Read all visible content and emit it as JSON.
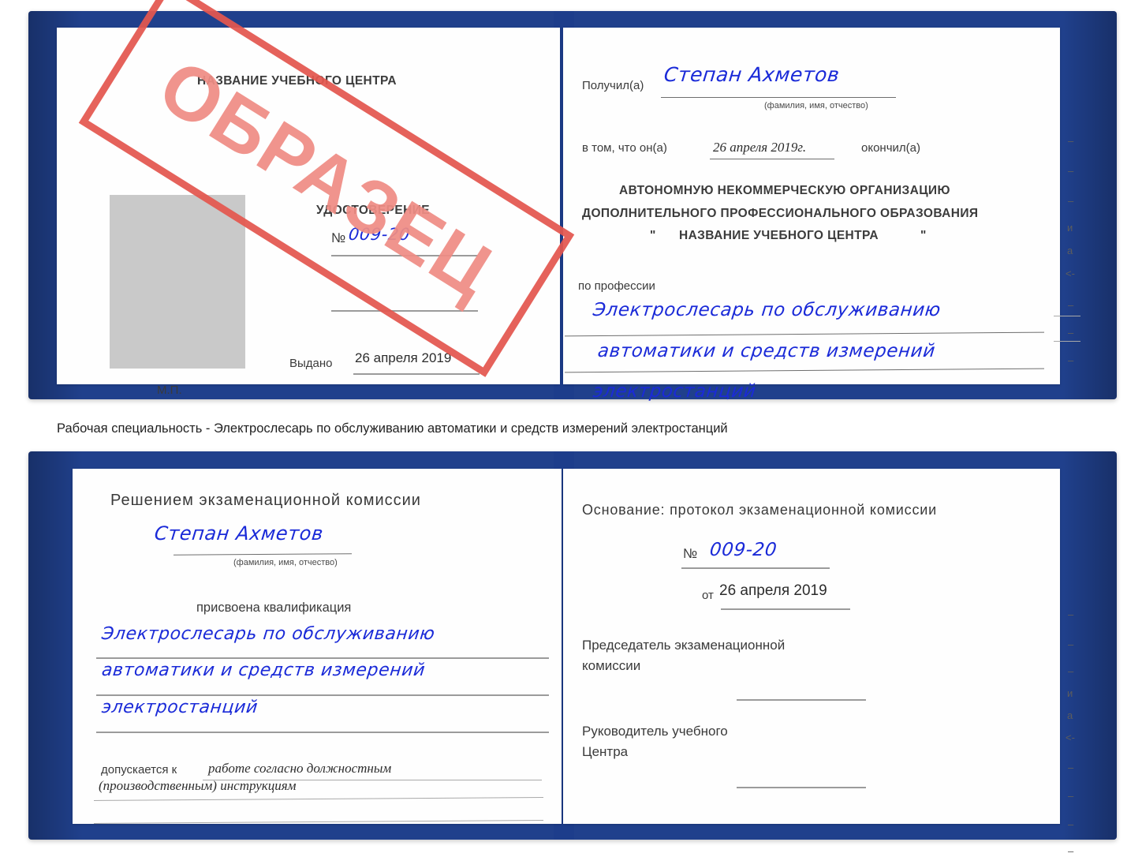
{
  "document": {
    "type": "certificate-scan",
    "colors": {
      "cover_blue": "#20408c",
      "handwriting_blue": "#1a2ad8",
      "stamp_red": "#e4574f",
      "stamp_fill": "#ef8d85",
      "photo_placeholder_gray": "#c9c9c9"
    }
  },
  "certificate_top": {
    "left_page": {
      "org_title": "НАЗВАНИЕ УЧЕБНОГО ЦЕНТРА",
      "doc_type": "УДОСТОВЕРЕНИЕ",
      "number_label": "№",
      "number_value": "009-20",
      "issued_label": "Выдано",
      "issued_value": "26 апреля 2019",
      "seal_label": "М.П.",
      "photo_placeholder": "photo-placeholder"
    },
    "right_page": {
      "received_label": "Получил(а)",
      "received_value": "Степан Ахметов",
      "fio_hint": "(фамилия, имя, отчество)",
      "in_that_label": "в том, что он(а)",
      "completion_date": "26 апреля 2019г.",
      "finished_label": "окончил(а)",
      "org_line1": "АВТОНОМНУЮ НЕКОММЕРЧЕСКУЮ ОРГАНИЗАЦИЮ",
      "org_line2": "ДОПОЛНИТЕЛЬНОГО ПРОФЕССИОНАЛЬНОГО ОБРАЗОВАНИЯ",
      "org_line3_quote_open": "\"",
      "org_line3": "НАЗВАНИЕ УЧЕБНОГО ЦЕНТРА",
      "org_line3_quote_close": "\"",
      "profession_label": "по профессии",
      "profession_line1": "Электрослесарь по обслуживанию",
      "profession_line2": "автоматики и средств измерений",
      "profession_line3": "электростанций",
      "edge_ghost_chars": [
        "–",
        "–",
        "–",
        "и",
        "а",
        "<-",
        "–",
        "–",
        "–"
      ]
    }
  },
  "caption": {
    "text": "Рабочая специальность - Электрослесарь по обслуживанию автоматики и средств измерений электростанций"
  },
  "certificate_bottom": {
    "left_page": {
      "commission_title": "Решением экзаменационной комиссии",
      "name_value": "Степан Ахметов",
      "fio_hint": "(фамилия, имя, отчество)",
      "qualification_label": "присвоена квалификация",
      "qual_line1": "Электрослесарь по обслуживанию",
      "qual_line2": "автоматики и средств измерений",
      "qual_line3": "электростанций",
      "admitted_label": "допускается к",
      "admitted_value_line1": "работе согласно должностным",
      "admitted_value_line2": "(производственным) инструкциям"
    },
    "right_page": {
      "basis_label": "Основание: протокол экзаменационной комиссии",
      "number_label": "№",
      "number_value": "009-20",
      "date_label": "от",
      "date_value": "26 апреля 2019",
      "chairman_line1": "Председатель экзаменационной",
      "chairman_line2": "комиссии",
      "head_line1": "Руководитель учебного",
      "head_line2": "Центра",
      "edge_ghost_chars": [
        "–",
        "–",
        "–",
        "и",
        "а",
        "<-",
        "–",
        "–",
        "–",
        "–"
      ]
    }
  },
  "stamp": {
    "text": "ОБРАЗЕЦ"
  }
}
